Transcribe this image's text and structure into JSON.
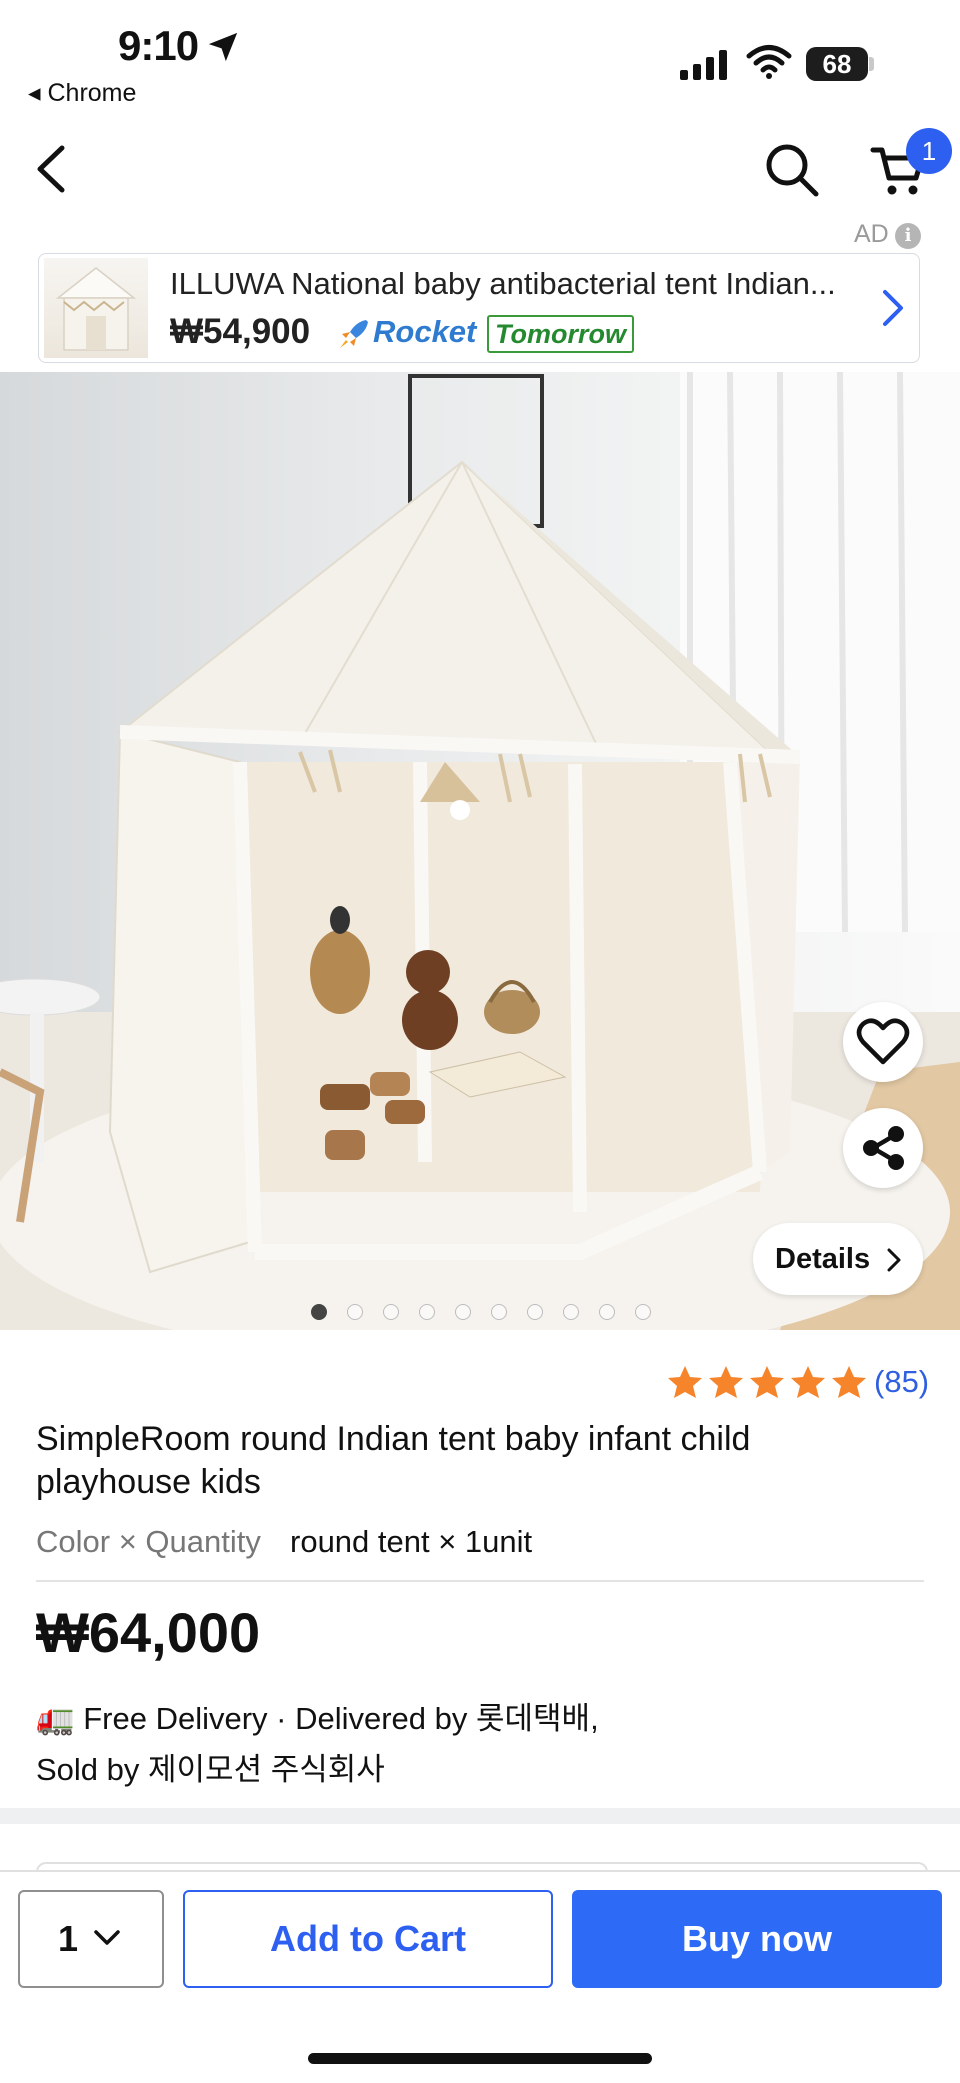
{
  "status_bar": {
    "time": "9:10",
    "back_app": "◂ Chrome",
    "battery": "68"
  },
  "nav": {
    "cart_count": "1"
  },
  "ad": {
    "label": "AD",
    "info_icon": "i",
    "title": "ILLUWA National baby antibacterial tent Indian...",
    "price": "₩54,900",
    "rocket": "Rocket",
    "delivery_badge": "Tomorrow"
  },
  "gallery": {
    "image_count": 10,
    "active_index": 0,
    "details_label": "Details"
  },
  "product": {
    "rating_count": "(85)",
    "rating_stars": 5,
    "title": "SimpleRoom round Indian tent baby infant child playhouse kids",
    "option_label": "Color × Quantity",
    "option_value": "round tent × 1unit",
    "price": "₩64,000",
    "delivery": "🚛 Free Delivery · Delivered by 롯데택배,",
    "seller": "Sold by 제이모션 주식회사"
  },
  "bottom_bar": {
    "quantity": "1",
    "add_to_cart": "Add to Cart",
    "buy_now": "Buy now"
  },
  "colors": {
    "accent": "#2d5ff0",
    "star": "#f5842a",
    "rocket": "#2e7bd0",
    "tomorrow": "#24892f"
  },
  "icons": [
    "location-arrow-icon",
    "signal-icon",
    "wifi-icon",
    "back-arrow-icon",
    "search-icon",
    "cart-icon",
    "chevron-right-icon",
    "heart-icon",
    "share-icon",
    "star-icon",
    "chevron-down-icon",
    "truck-icon"
  ]
}
